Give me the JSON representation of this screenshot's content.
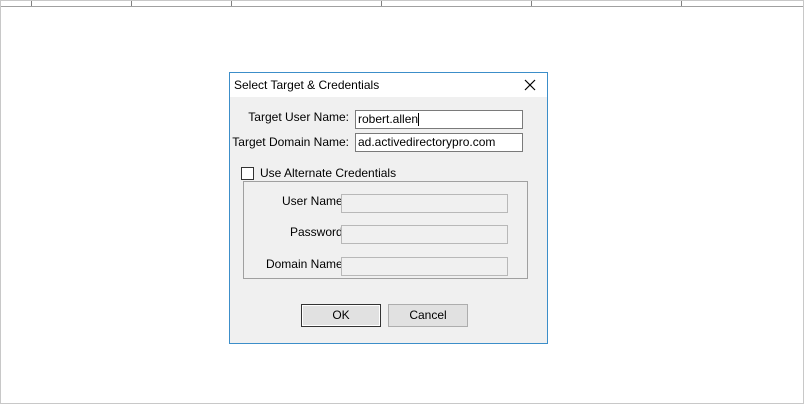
{
  "dialog": {
    "title": "Select Target & Credentials",
    "close_icon": "close-icon"
  },
  "target": {
    "user_label": "Target User Name:",
    "user_value": "robert.allen",
    "domain_label": "Target Domain Name:",
    "domain_value": "ad.activedirectorypro.com"
  },
  "alternate": {
    "checkbox_label": "Use Alternate Credentials",
    "checked": false,
    "user_label": "User Name:",
    "user_value": "",
    "password_label": "Password:",
    "password_value": "",
    "domain_label": "Domain Name:",
    "domain_value": ""
  },
  "buttons": {
    "ok_label": "OK",
    "cancel_label": "Cancel"
  },
  "colors": {
    "dialog_border": "#3c8ec9",
    "dialog_bg": "#f0f0f0"
  }
}
